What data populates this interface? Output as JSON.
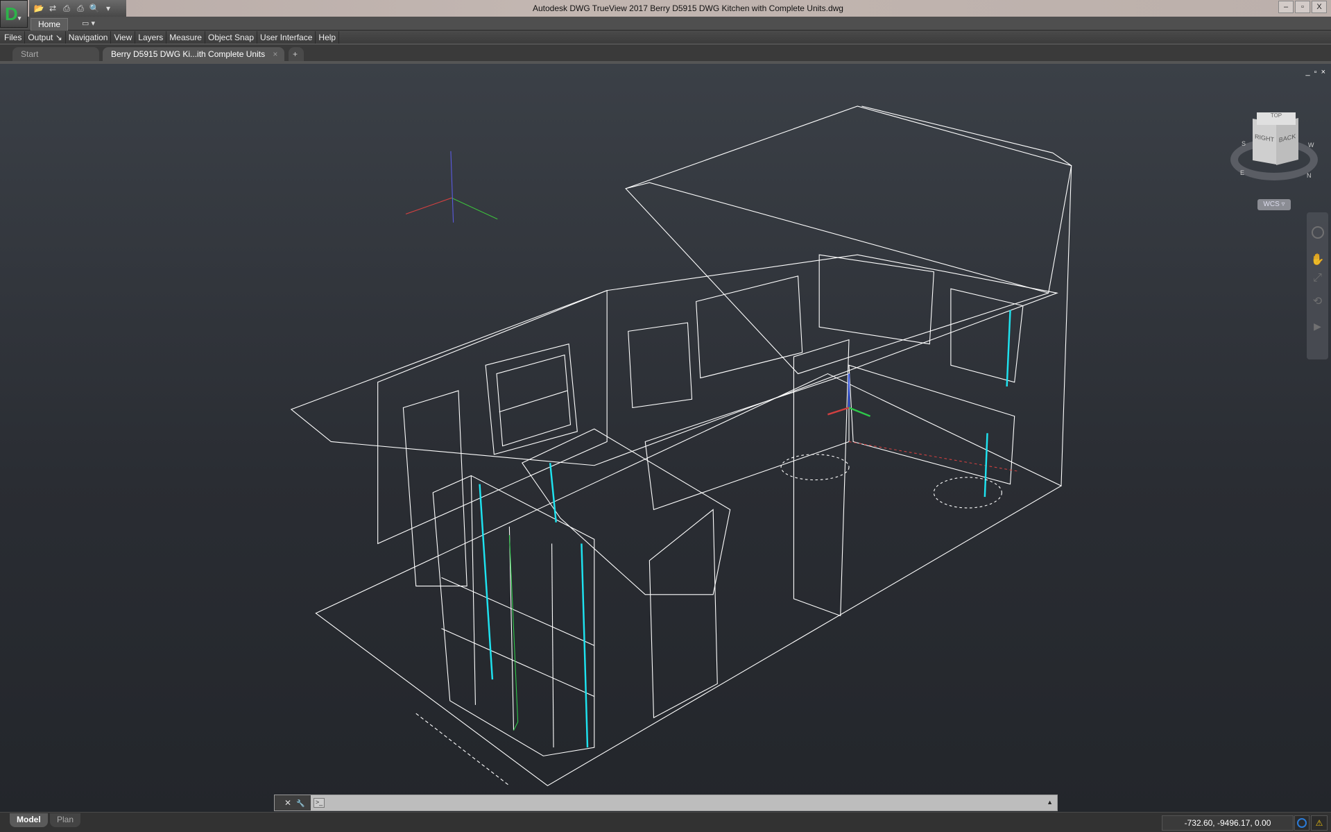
{
  "window": {
    "title": "Autodesk DWG TrueView 2017    Berry D5915 DWG Kitchen with Complete Units.dwg",
    "controls": [
      "minimize",
      "restore",
      "close"
    ]
  },
  "app_button": {
    "letter": "D"
  },
  "quick_access": [
    "open-icon",
    "dwg-convert-icon",
    "plot-icon",
    "batch-plot-icon",
    "preview-icon",
    "customize-icon"
  ],
  "ribbon": {
    "tabs": [
      {
        "label": "Home"
      }
    ],
    "extra": "▭ ▾"
  },
  "menu": [
    "Files",
    "Output ↘",
    "Navigation",
    "View",
    "Layers",
    "Measure",
    "Object Snap",
    "User Interface",
    "Help"
  ],
  "doc_tabs": [
    {
      "label": "Start"
    },
    {
      "label": "Berry D5915 DWG Ki...ith Complete Units",
      "close": "×"
    }
  ],
  "new_tab": "+",
  "viewport": {
    "controls": [
      "_",
      "▫",
      "×"
    ]
  },
  "viewcube": {
    "faces": [
      "RIGHT",
      "BACK",
      "TOP"
    ],
    "compass": [
      "S",
      "W",
      "E",
      "N"
    ],
    "ucs": "WCS ▿"
  },
  "command_line": {
    "close": "✕",
    "settings": "🔧",
    "prompt": ">_",
    "value": ""
  },
  "layout_tabs": [
    {
      "label": "Model",
      "active": true
    },
    {
      "label": "Plan",
      "active": false
    }
  ],
  "status": {
    "coordinates": "-732.60, -9496.17, 0.00"
  },
  "colors": {
    "viewport_top": "#3b4047",
    "viewport_bottom": "#23262b",
    "wire": "#ffffff",
    "cyan": "#1ee3f0",
    "green": "#2ec84a"
  }
}
